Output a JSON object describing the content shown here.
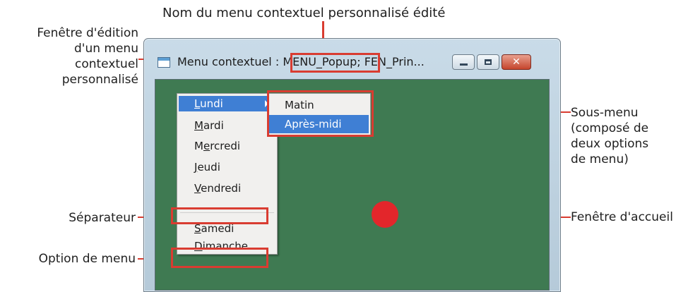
{
  "top_caption": "Nom du menu contextuel personnalisé édité",
  "callouts": {
    "edit_window": "Fenêtre d'édition\nd'un menu\ncontextuel\npersonnalisé",
    "separator": "Séparateur",
    "menu_option": "Option de menu",
    "submenu": "Sous-menu\n(composé de\ndeux options\nde menu)",
    "home_window": "Fenêtre d'accueil"
  },
  "window": {
    "title_prefix": "Menu contextuel : ",
    "menu_name": "MENU_Popup",
    "title_suffix": "; FEN_Prin...",
    "min_glyph": "",
    "max_glyph": "",
    "close_glyph": "✕"
  },
  "context_menu": {
    "items": [
      {
        "accel": "L",
        "rest": "undi",
        "selected": true,
        "has_submenu": true
      },
      {
        "accel": "M",
        "rest": "ardi"
      },
      {
        "pre": "M",
        "accel": "e",
        "rest": "rcredi"
      },
      {
        "accel": "J",
        "rest": "eudi"
      },
      {
        "accel": "V",
        "rest": "endredi"
      },
      {
        "separator": true
      },
      {
        "accel": "S",
        "rest": "amedi"
      },
      {
        "accel": "D",
        "rest": "imanche"
      }
    ]
  },
  "submenu": {
    "items": [
      {
        "label": "Matin",
        "selected": false
      },
      {
        "label": "Après-midi",
        "selected": true
      }
    ]
  },
  "colors": {
    "accent_red": "#d93c31",
    "client_green": "#3f7a52",
    "selection_blue": "#3f7fd4",
    "dot_red": "#e3262b"
  }
}
